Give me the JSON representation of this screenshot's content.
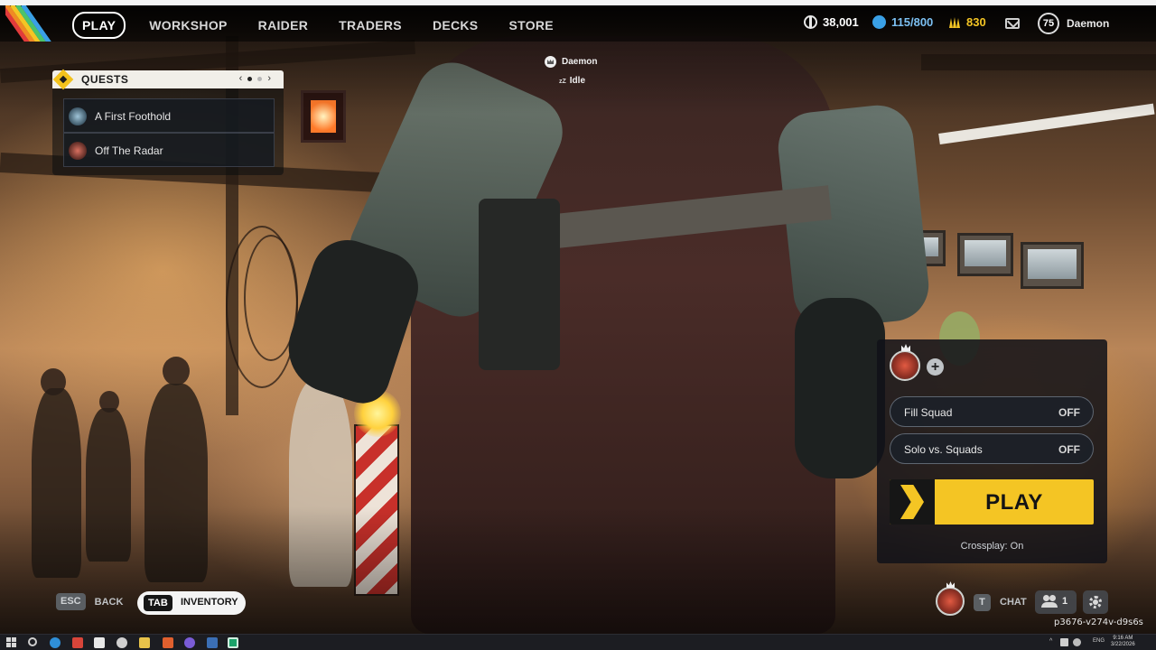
{
  "nav": {
    "items": [
      "PLAY",
      "WORKSHOP",
      "RAIDER",
      "TRADERS",
      "DECKS",
      "STORE"
    ],
    "active": "PLAY"
  },
  "currencies": {
    "coins": "38,001",
    "cred": "115/800",
    "tokens": "830"
  },
  "profile": {
    "level": "75",
    "name": "Daemon"
  },
  "quests": {
    "title": "QUESTS",
    "page_prev": "‹",
    "page_next": "›",
    "items": [
      {
        "label": "A First Foothold",
        "icon": "quest-portrait-blue"
      },
      {
        "label": "Off The Radar",
        "icon": "quest-portrait-red"
      }
    ]
  },
  "player_tag": {
    "name": "Daemon",
    "status": "Idle"
  },
  "squad": {
    "options": [
      {
        "label": "Fill Squad",
        "value": "OFF"
      },
      {
        "label": "Solo vs. Squads",
        "value": "OFF"
      }
    ],
    "play_label": "PLAY",
    "crossplay": "Crossplay: On"
  },
  "controls": {
    "back_key": "ESC",
    "back_label": "BACK",
    "inventory_key": "TAB",
    "inventory_label": "INVENTORY",
    "chat_key": "T",
    "chat_label": "CHAT",
    "friends_count": "1"
  },
  "session_id": "p3676-v274v-d9s6s",
  "taskbar": {
    "language": "ENG",
    "time": "9:16 AM",
    "date": "3/22/2026"
  },
  "colors": {
    "accent_yellow": "#f4c524",
    "panel_dark": "#10121a",
    "quest_header": "#f1efe9"
  }
}
